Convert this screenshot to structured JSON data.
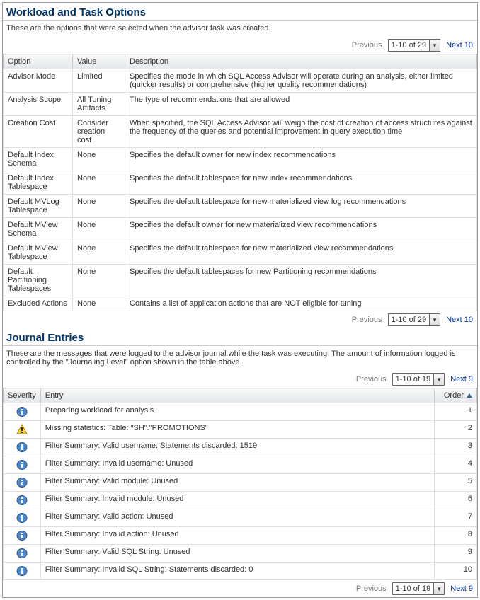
{
  "workload": {
    "title": "Workload and Task Options",
    "desc": "These are the options that were selected when the advisor task was created.",
    "pagerPrev": "Previous",
    "pagerNext": "Next 10",
    "pagerRange": "1-10 of 29",
    "columns": {
      "option": "Option",
      "value": "Value",
      "description": "Description"
    },
    "rows": [
      {
        "option": "Advisor Mode",
        "value": "Limited",
        "description": "Specifies the mode in which SQL Access Advisor will operate during an analysis, either limited (quicker results) or comprehensive (higher quality recommendations)"
      },
      {
        "option": "Analysis Scope",
        "value": "All Tuning Artifacts",
        "description": "The type of recommendations that are allowed"
      },
      {
        "option": "Creation Cost",
        "value": "Consider creation cost",
        "description": "When specified, the SQL Access Advisor will weigh the cost of creation of access structures against the frequency of the queries and potential improvement in query execution time"
      },
      {
        "option": "Default Index Schema",
        "value": "None",
        "description": "Specifies the default owner for new index recommendations"
      },
      {
        "option": "Default Index Tablespace",
        "value": "None",
        "description": "Specifies the default tablespace for new index recommendations"
      },
      {
        "option": "Default MVLog Tablespace",
        "value": "None",
        "description": "Specifies the default tablespace for new materialized view log recommendations"
      },
      {
        "option": "Default MView Schema",
        "value": "None",
        "description": "Specifies the default owner for new materialized view recommendations"
      },
      {
        "option": "Default MView Tablespace",
        "value": "None",
        "description": "Specifies the default tablespace for new materialized view recommendations"
      },
      {
        "option": "Default Partitioning Tablespaces",
        "value": "None",
        "description": "Specifies the default tablespaces for new Partitioning recommendations"
      },
      {
        "option": "Excluded Actions",
        "value": "None",
        "description": "Contains a list of application actions that are NOT eligible for tuning"
      }
    ]
  },
  "journal": {
    "title": "Journal Entries",
    "desc": "These are the messages that were logged to the advisor journal while the task was executing. The amount of information logged is controlled by the \"Journaling Level\" option shown in the table above.",
    "pagerPrev": "Previous",
    "pagerNext": "Next 9",
    "pagerRange": "1-10 of 19",
    "columns": {
      "severity": "Severity",
      "entry": "Entry",
      "order": "Order"
    },
    "rows": [
      {
        "severity": "info",
        "entry": "Preparing workload for analysis",
        "order": "1"
      },
      {
        "severity": "warn",
        "entry": "Missing statistics: Table: \"SH\".\"PROMOTIONS\"",
        "order": "2"
      },
      {
        "severity": "info",
        "entry": "Filter Summary: Valid username: Statements discarded: 1519",
        "order": "3"
      },
      {
        "severity": "info",
        "entry": "Filter Summary: Invalid username: Unused",
        "order": "4"
      },
      {
        "severity": "info",
        "entry": "Filter Summary: Valid module: Unused",
        "order": "5"
      },
      {
        "severity": "info",
        "entry": "Filter Summary: Invalid module: Unused",
        "order": "6"
      },
      {
        "severity": "info",
        "entry": "Filter Summary: Valid action: Unused",
        "order": "7"
      },
      {
        "severity": "info",
        "entry": "Filter Summary: Invalid action: Unused",
        "order": "8"
      },
      {
        "severity": "info",
        "entry": "Filter Summary: Valid SQL String: Unused",
        "order": "9"
      },
      {
        "severity": "info",
        "entry": "Filter Summary: Invalid SQL String: Statements discarded: 0",
        "order": "10"
      }
    ]
  }
}
